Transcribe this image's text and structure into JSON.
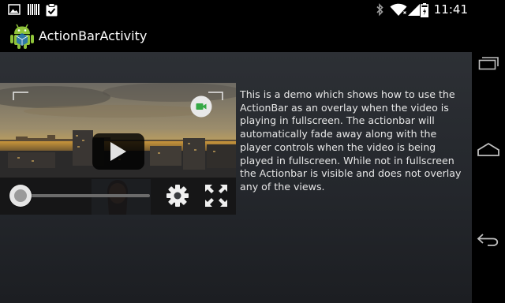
{
  "status_bar": {
    "time": "11:41",
    "left_icons": [
      "image-icon",
      "barcode-icon",
      "clipboard-check-icon"
    ],
    "right_icons": [
      "bluetooth-icon",
      "wifi-icon",
      "signal-icon",
      "battery-icon"
    ]
  },
  "action_bar": {
    "title": "ActionBarActivity",
    "icon": "android-icon"
  },
  "video": {
    "play_icon": "play-icon",
    "camera_icon": "video-camera-icon",
    "settings_icon": "gear-icon",
    "fullscreen_icon": "fullscreen-icon"
  },
  "description": "This is a demo which shows how to use the ActionBar as an overlay when the video is playing in fullscreen. The actionbar will automatically fade away along with the player controls when the video is being played in fullscreen. While not in fullscreen the Actionbar is visible and does not overlay any of the views.",
  "nav_bar": {
    "recent_icon": "recent-apps-icon",
    "home_icon": "home-icon",
    "back_icon": "back-icon"
  },
  "colors": {
    "background": "#000000",
    "content_bg": "#282b30",
    "text": "#e6e6e6",
    "camera_button": "#e8e8e8",
    "camera_icon": "#35a845"
  }
}
